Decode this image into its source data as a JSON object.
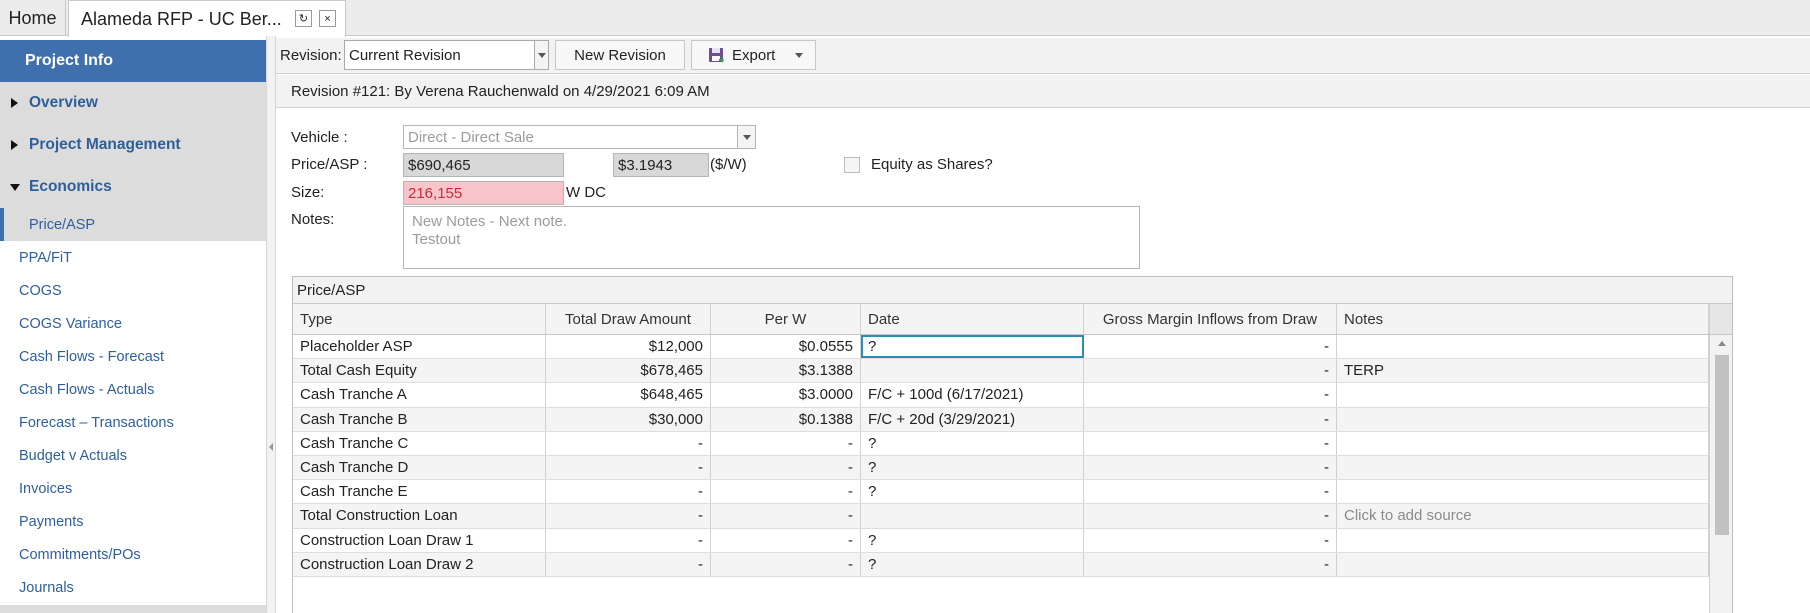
{
  "tabs": {
    "home": "Home",
    "active": "Alameda RFP - UC Ber...",
    "refresh_glyph": "↻",
    "close_glyph": "×"
  },
  "sidebar": {
    "header": "Project Info",
    "sections": [
      {
        "label": "Overview",
        "expanded": false
      },
      {
        "label": "Project Management",
        "expanded": false
      },
      {
        "label": "Economics",
        "expanded": true
      }
    ],
    "selected": "Price/ASP",
    "links": [
      "PPA/FiT",
      "COGS",
      "COGS Variance",
      "Cash Flows - Forecast",
      "Cash Flows - Actuals",
      "Forecast – Transactions",
      "Budget v Actuals",
      "Invoices",
      "Payments",
      "Commitments/POs",
      "Journals"
    ]
  },
  "toolbar": {
    "revision_label": "Revision:",
    "revision_value": "Current Revision",
    "new_revision": "New Revision",
    "export": "Export"
  },
  "revision_header": "Revision #121: By Verena Rauchenwald on 4/29/2021 6:09 AM",
  "form": {
    "vehicle_label": "Vehicle :",
    "vehicle_value": "Direct - Direct Sale",
    "price_label": "Price/ASP :",
    "price_value": "$690,465",
    "per_w_value": "$3.1943",
    "per_w_unit": "($/W)",
    "equity_label": "Equity as Shares?",
    "size_label": "Size:",
    "size_value": "216,155",
    "size_unit": "W DC",
    "notes_label": "Notes:",
    "notes_line1": "New Notes - Next note.",
    "notes_line2": "Testout"
  },
  "grid": {
    "title": "Price/ASP",
    "columns": [
      "Type",
      "Total Draw Amount",
      "Per W",
      "Date",
      "Gross Margin Inflows from Draw",
      "Notes"
    ],
    "rows": [
      {
        "type": "Placeholder ASP",
        "total": "$12,000",
        "per_w": "$0.0555",
        "date": "?",
        "gm": "-",
        "notes": ""
      },
      {
        "type": "Total Cash Equity",
        "total": "$678,465",
        "per_w": "$3.1388",
        "date": "",
        "gm": "-",
        "notes": "TERP"
      },
      {
        "type": "Cash Tranche A",
        "total": "$648,465",
        "per_w": "$3.0000",
        "date": "F/C + 100d (6/17/2021)",
        "gm": "-",
        "notes": ""
      },
      {
        "type": "Cash Tranche B",
        "total": "$30,000",
        "per_w": "$0.1388",
        "date": "F/C + 20d (3/29/2021)",
        "gm": "-",
        "notes": ""
      },
      {
        "type": "Cash Tranche C",
        "total": "-",
        "per_w": "-",
        "date": "?",
        "gm": "-",
        "notes": ""
      },
      {
        "type": "Cash Tranche D",
        "total": "-",
        "per_w": "-",
        "date": "?",
        "gm": "-",
        "notes": ""
      },
      {
        "type": "Cash Tranche E",
        "total": "-",
        "per_w": "-",
        "date": "?",
        "gm": "-",
        "notes": ""
      },
      {
        "type": "Total Construction Loan",
        "total": "-",
        "per_w": "-",
        "date": "",
        "gm": "-",
        "notes": "Click to add source"
      },
      {
        "type": "Construction Loan Draw 1",
        "total": "-",
        "per_w": "-",
        "date": "?",
        "gm": "-",
        "notes": ""
      },
      {
        "type": "Construction Loan Draw 2",
        "total": "-",
        "per_w": "-",
        "date": "?",
        "gm": "-",
        "notes": ""
      }
    ]
  },
  "colors": {
    "accent": "#3f6fad",
    "link": "#2f5f9a",
    "error_bg": "#f7c5c9",
    "error_text": "#c0303b",
    "selection": "#2a8fb0"
  }
}
